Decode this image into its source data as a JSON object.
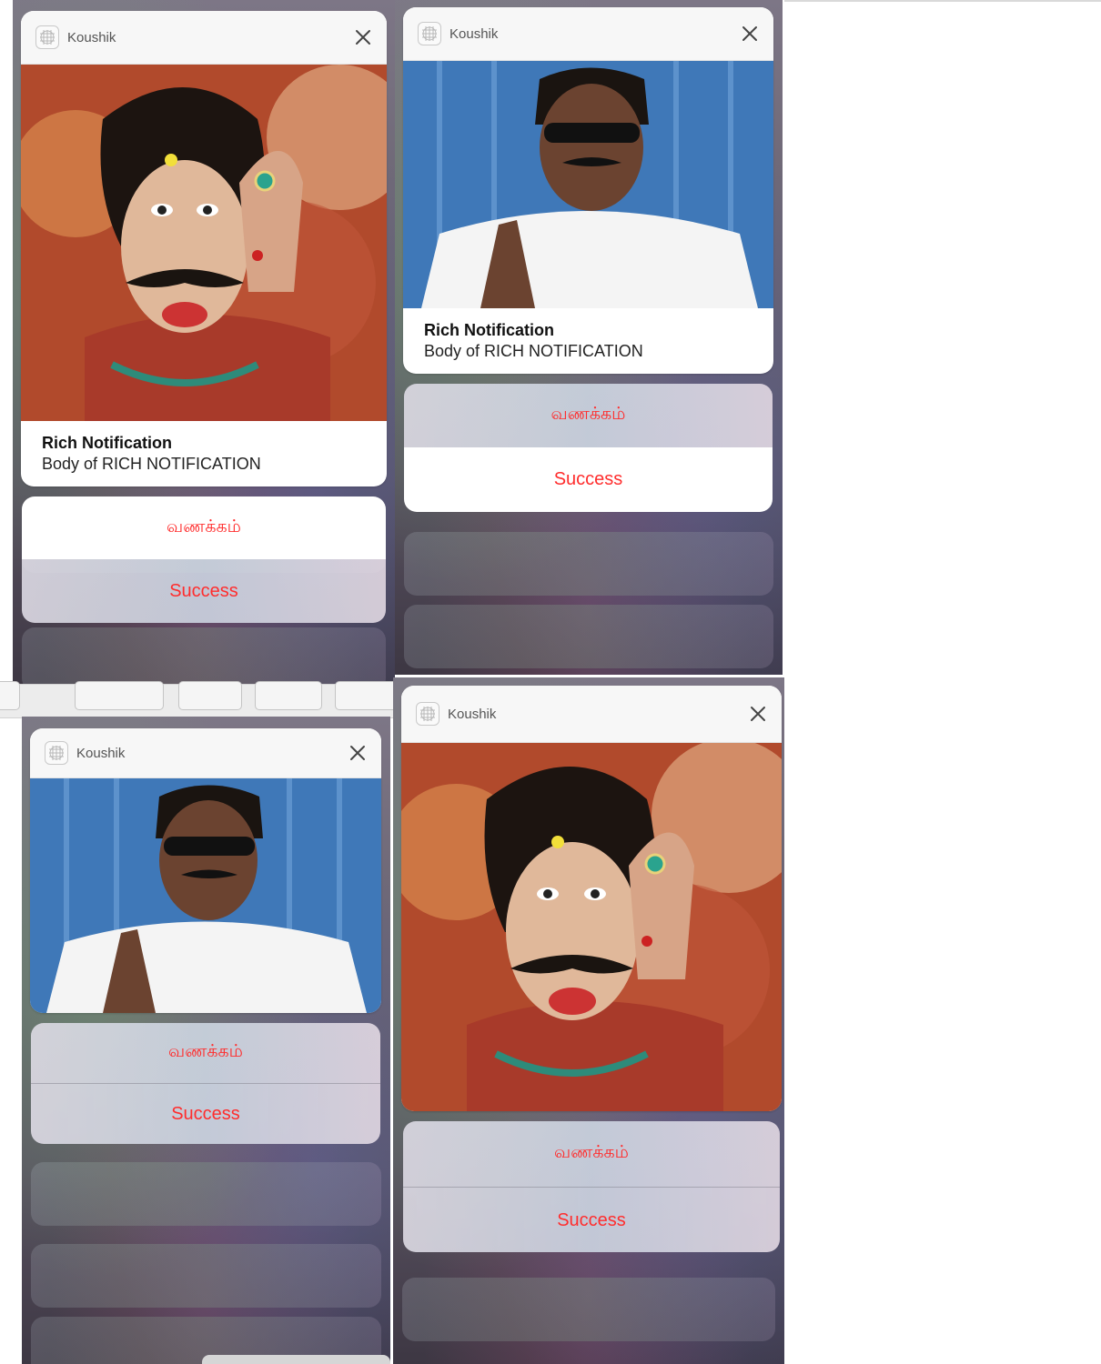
{
  "app_name": "Koushik",
  "notification": {
    "title": "Rich Notification",
    "body": "Body of RICH NOTIFICATION"
  },
  "actions": {
    "greeting": "வணக்கம்",
    "success": "Success"
  },
  "colors": {
    "action_text": "#ff2d2d",
    "card_bg": "#ffffff",
    "header_bg": "#f7f7f7"
  },
  "icons": {
    "app": "app-grid-icon",
    "close": "close-icon"
  },
  "media": {
    "photo_costume": "actor-costume-photo",
    "photo_sunglasses": "actor-sunglasses-photo"
  }
}
